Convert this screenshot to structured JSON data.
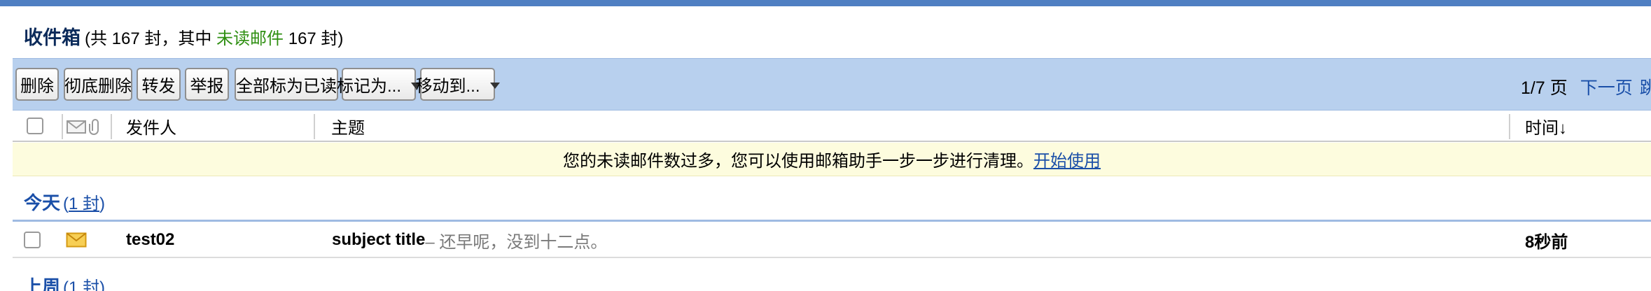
{
  "header": {
    "title": "收件箱",
    "stats_open": "(共 167 封，其中 ",
    "unread_label": "未读邮件",
    "stats_close": " 167 封)"
  },
  "toolbar": {
    "delete": "删除",
    "delete_permanently": "彻底删除",
    "forward": "转发",
    "report": "举报",
    "mark_all_read": "全部标为已读",
    "mark_as": "标记为...",
    "move_to": "移动到...",
    "page_info": "1/7 页",
    "next_page": "下一页",
    "jump": "跳"
  },
  "columns": {
    "sender": "发件人",
    "subject": "主题",
    "time": "时间↓"
  },
  "notice": {
    "text": "您的未读邮件数过多，您可以使用邮箱助手一步一步进行清理。",
    "link": "开始使用"
  },
  "groups": [
    {
      "name": "今天",
      "count_open": "(",
      "count": "1 封",
      "count_close": ")"
    },
    {
      "name": "上周",
      "count_open": "(",
      "count": "1 封",
      "count_close": ")"
    }
  ],
  "emails": [
    {
      "sender": "test02",
      "subject": "subject title",
      "preview": " – 还早呢，没到十二点。",
      "time": "8秒前",
      "unread": true,
      "icon": "envelope-icon"
    }
  ],
  "colors": {
    "top_strip": "#4f7fc2",
    "toolbar_bg": "#b8d0ee",
    "unread_green": "#2f8f12",
    "link_blue": "#1a4fa8",
    "notice_bg": "#fdfcde",
    "envelope": "#f3b82a"
  }
}
